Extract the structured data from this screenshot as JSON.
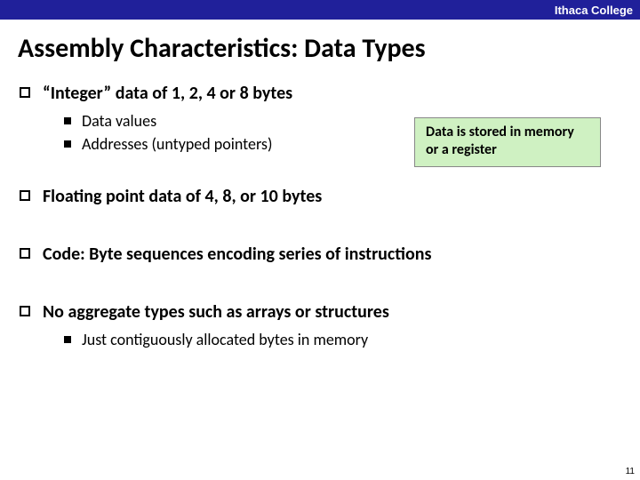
{
  "header": {
    "org": "Ithaca College"
  },
  "title": "Assembly Characteristics: Data Types",
  "bullets": {
    "b1": {
      "text": "“Integer” data of 1, 2, 4 or 8 bytes"
    },
    "b1_sub": {
      "s1": "Data values",
      "s2": "Addresses (untyped pointers)"
    },
    "callout": {
      "text": "Data is stored in memory or a register"
    },
    "b2": {
      "text": "Floating point data of 4, 8, or 10 bytes"
    },
    "b3": {
      "text": "Code: Byte sequences encoding series of instructions"
    },
    "b4": {
      "text": "No aggregate types such as arrays or structures"
    },
    "b4_sub": {
      "s1": "Just contiguously allocated bytes in memory"
    }
  },
  "page_number": "11"
}
